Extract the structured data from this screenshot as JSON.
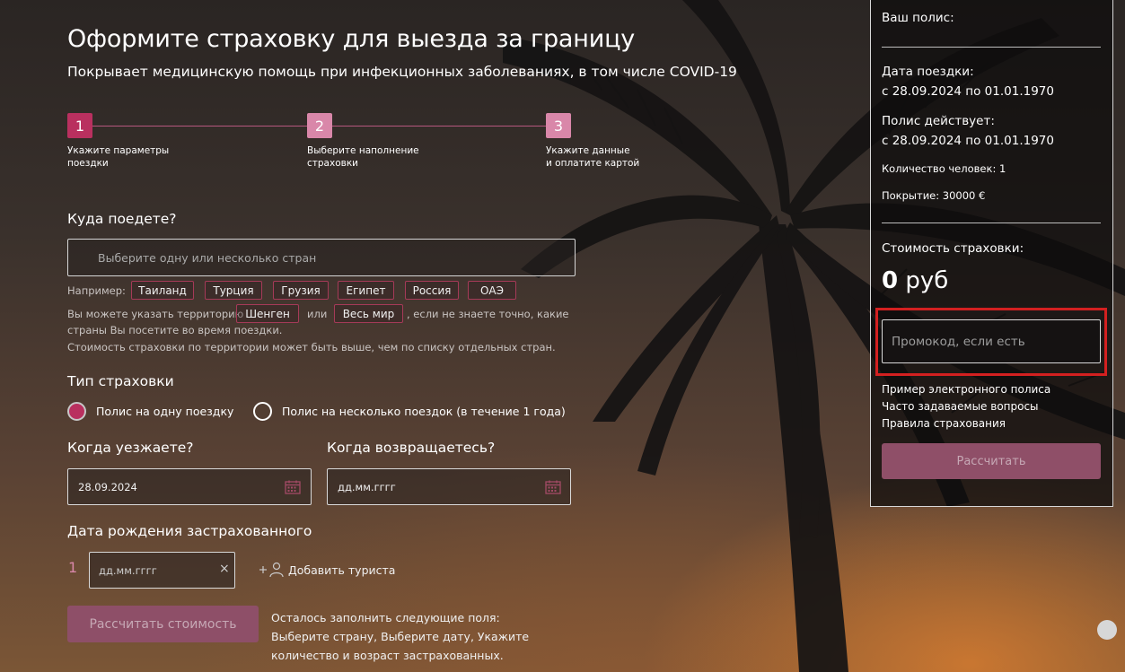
{
  "header": {
    "title": "Оформите страховку для выезда за границу",
    "subtitle": "Покрывает медицинскую помощь при инфекционных заболеваниях, в том числе COVID-19"
  },
  "steps": [
    {
      "num": "1",
      "label_line1": "Укажите параметры",
      "label_line2": "поездки"
    },
    {
      "num": "2",
      "label_line1": "Выберите наполнение",
      "label_line2": "страховки"
    },
    {
      "num": "3",
      "label_line1": "Укажите данные",
      "label_line2": "и оплатите картой"
    }
  ],
  "destination": {
    "heading": "Куда поедете?",
    "placeholder": "Выберите одну или несколько стран",
    "example_label": "Например:",
    "examples": [
      "Таиланд",
      "Турция",
      "Грузия",
      "Египет",
      "Россия",
      "ОАЭ"
    ],
    "territory_prefix": "Вы можете указать территорию",
    "territory_schengen": "Шенген",
    "territory_or": "или",
    "territory_world": "Весь мир",
    "territory_suffix": ", если не знаете точно, какие",
    "territory_line2": "страны Вы посетите во время поездки.",
    "territory_line3": "Стоимость страховки по территории может быть выше, чем по списку отдельных стран."
  },
  "insurance_type": {
    "heading": "Тип страховки",
    "option_single": "Полис на одну поездку",
    "option_multi": "Полис на несколько поездок (в течение 1 года)",
    "selected": "single"
  },
  "dates": {
    "depart_heading": "Когда уезжаете?",
    "depart_value": "28.09.2024",
    "return_heading": "Когда возвращаетесь?",
    "return_placeholder": "дд.мм.гггг"
  },
  "birth": {
    "heading": "Дата рождения застрахованного",
    "index": "1",
    "placeholder": "дд.мм.гггг",
    "clear_glyph": "×",
    "add_tourist": "Добавить туриста"
  },
  "footer": {
    "calc_button": "Рассчитать стоимость",
    "remain_line1": "Осталось заполнить следующие поля:",
    "remain_line2": "Выберите страну, Выберите дату, Укажите",
    "remain_line3": "количество и возраст застрахованных."
  },
  "summary": {
    "policy_label": "Ваш полис:",
    "trip_date_label": "Дата поездки:",
    "trip_date_value": "с 28.09.2024 по 01.01.1970",
    "valid_label": "Полис действует:",
    "valid_value": "с 28.09.2024 по 01.01.1970",
    "people": "Количество человек: 1",
    "coverage": "Покрытие: 30000 €",
    "cost_label": "Стоимость страховки:",
    "price_amount": "0",
    "price_currency": "руб",
    "promo_placeholder": "Промокод, если есть",
    "links": [
      "Пример электронного полиса",
      "Часто задаваемые вопросы",
      "Правила страхования"
    ],
    "calc_button": "Рассчитать"
  },
  "colors": {
    "accent": "#b9305f",
    "accent_light": "#d987a9",
    "button_disabled": "#8e4f68",
    "highlight": "#d32020"
  }
}
